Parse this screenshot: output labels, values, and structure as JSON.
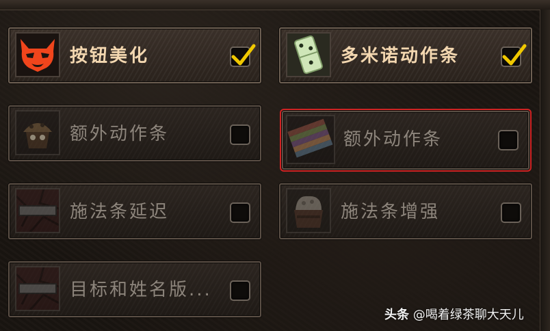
{
  "addons": [
    {
      "label": "按钮美化",
      "enabled": true,
      "icon": "red-demon-mask-icon"
    },
    {
      "label": "多米诺动作条",
      "enabled": true,
      "icon": "domino-tile-icon"
    },
    {
      "label": "额外动作条",
      "enabled": false,
      "icon": "cupcake-creature-icon"
    },
    {
      "label": "额外动作条",
      "enabled": false,
      "highlighted": true,
      "icon": "striped-blanket-icon"
    },
    {
      "label": "施法条延迟",
      "enabled": false,
      "icon": "castbar-frame-icon"
    },
    {
      "label": "施法条增强",
      "enabled": false,
      "icon": "rock-cauldron-icon"
    },
    {
      "label": "目标和姓名版...",
      "enabled": false,
      "icon": "castbar-frame-icon"
    }
  ],
  "watermark": {
    "brand": "头条",
    "handle": "@喝着绿茶聊大天儿"
  },
  "colors": {
    "enabled_text": "#f3d7b0",
    "disabled_text": "#8d857c",
    "checkmark": "#f0c800",
    "highlight_outline": "#d02424"
  }
}
